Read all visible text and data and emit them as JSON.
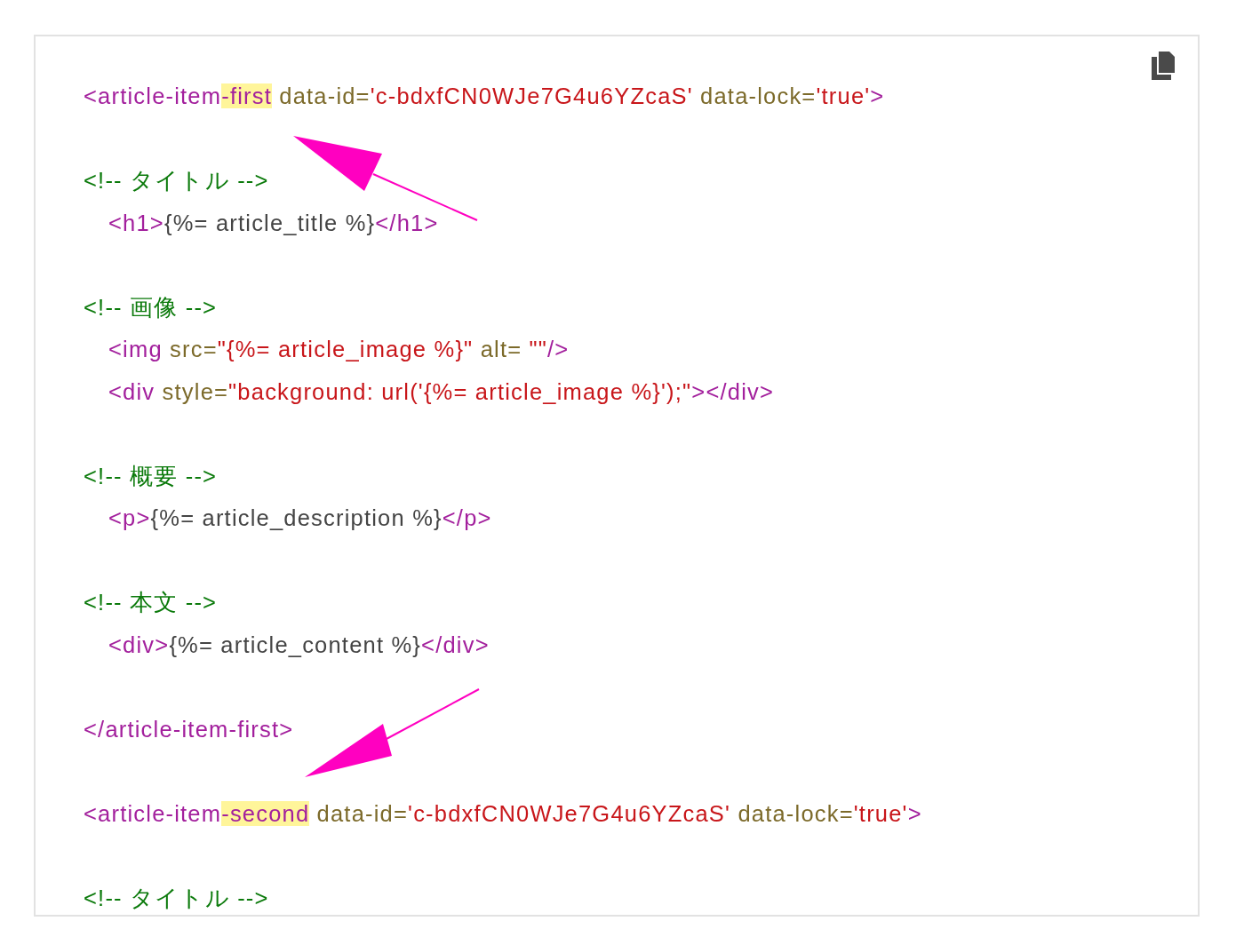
{
  "code_blocks": [
    {
      "lines": [
        {
          "tokens": [
            {
              "kind": "tag",
              "text": "<article-item"
            },
            {
              "kind": "tag",
              "text": "-first",
              "highlighted": true
            },
            {
              "kind": "attr",
              "text": " data-id="
            },
            {
              "kind": "string",
              "text": "'c-bdxfCN0WJe7G4u6YZcaS'"
            },
            {
              "kind": "attr",
              "text": " data-lock="
            },
            {
              "kind": "string",
              "text": "'true'"
            },
            {
              "kind": "tag",
              "text": ">"
            }
          ]
        }
      ]
    },
    {
      "lines": [
        {
          "tokens": [
            {
              "kind": "comment",
              "text": "<!-- タイトル -->"
            }
          ],
          "children": [
            {
              "tokens": [
                {
                  "kind": "tag",
                  "text": "<h1>"
                },
                {
                  "kind": "text",
                  "text": "{%= article_title %}"
                },
                {
                  "kind": "tag",
                  "text": "</h1>"
                }
              ]
            }
          ]
        }
      ]
    },
    {
      "lines": [
        {
          "tokens": [
            {
              "kind": "comment",
              "text": "<!-- 画像 -->"
            }
          ],
          "children": [
            {
              "tokens": [
                {
                  "kind": "tag",
                  "text": "<img"
                },
                {
                  "kind": "attr",
                  "text": " src="
                },
                {
                  "kind": "string",
                  "text": "\"{%= article_image %}\""
                },
                {
                  "kind": "attr",
                  "text": " alt= "
                },
                {
                  "kind": "string",
                  "text": "\"\""
                },
                {
                  "kind": "tag",
                  "text": "/>"
                }
              ]
            },
            {
              "tokens": [
                {
                  "kind": "tag",
                  "text": "<div"
                },
                {
                  "kind": "attr",
                  "text": " style="
                },
                {
                  "kind": "string",
                  "text": "\"background: url('{%= article_image %}');\""
                },
                {
                  "kind": "tag",
                  "text": "></div>"
                }
              ]
            }
          ]
        }
      ]
    },
    {
      "lines": [
        {
          "tokens": [
            {
              "kind": "comment",
              "text": "<!-- 概要 -->"
            }
          ],
          "children": [
            {
              "tokens": [
                {
                  "kind": "tag",
                  "text": "<p>"
                },
                {
                  "kind": "text",
                  "text": "{%= article_description %}"
                },
                {
                  "kind": "tag",
                  "text": "</p>"
                }
              ]
            }
          ]
        }
      ]
    },
    {
      "lines": [
        {
          "tokens": [
            {
              "kind": "comment",
              "text": "<!-- 本文 -->"
            }
          ],
          "children": [
            {
              "tokens": [
                {
                  "kind": "tag",
                  "text": "<div>"
                },
                {
                  "kind": "text",
                  "text": "{%= article_content %}"
                },
                {
                  "kind": "tag",
                  "text": "</div>"
                }
              ]
            }
          ]
        }
      ]
    },
    {
      "lines": [
        {
          "tokens": [
            {
              "kind": "tag",
              "text": "</article-item-first>"
            }
          ]
        }
      ]
    },
    {
      "lines": [
        {
          "tokens": [
            {
              "kind": "tag",
              "text": "<article-item"
            },
            {
              "kind": "tag",
              "text": "-second",
              "highlighted": true
            },
            {
              "kind": "attr",
              "text": " data-id="
            },
            {
              "kind": "string",
              "text": "'c-bdxfCN0WJe7G4u6YZcaS'"
            },
            {
              "kind": "attr",
              "text": " data-lock="
            },
            {
              "kind": "string",
              "text": "'true'"
            },
            {
              "kind": "tag",
              "text": ">"
            }
          ]
        }
      ]
    },
    {
      "lines": [
        {
          "tokens": [
            {
              "kind": "comment",
              "text": "<!-- タイトル -->"
            }
          ]
        }
      ]
    }
  ]
}
